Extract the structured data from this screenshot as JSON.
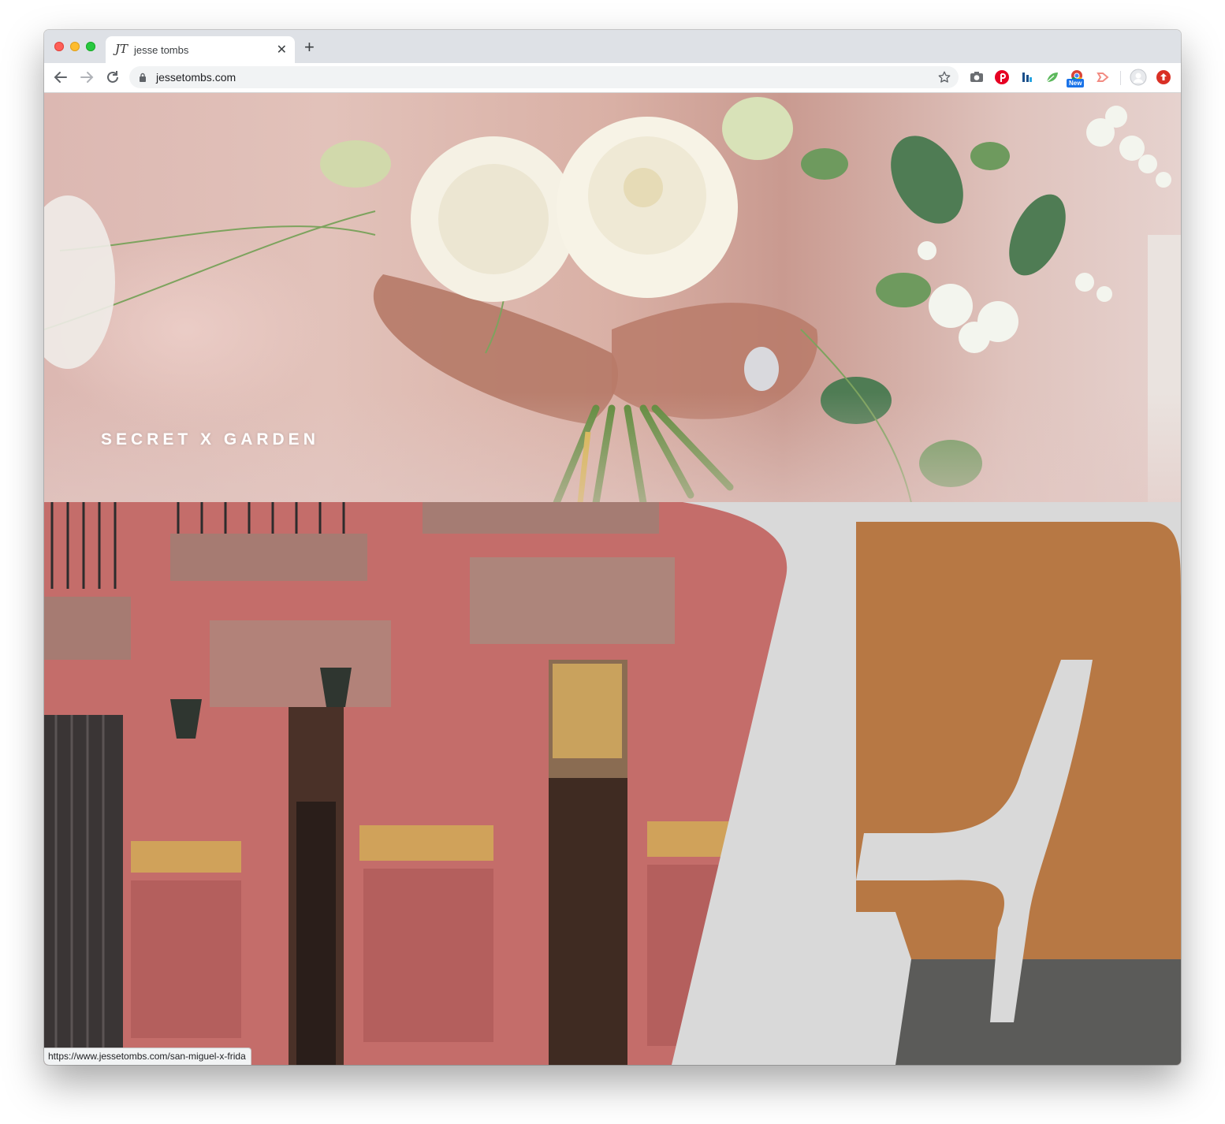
{
  "browser": {
    "tab": {
      "favicon": "JT",
      "title": "jesse tombs"
    },
    "new_tab_label": "+",
    "close_label": "✕",
    "address": "jessetombs.com",
    "extensions": [
      "camera-icon",
      "pinterest-icon",
      "analytics-icon",
      "leaf-icon",
      "chrome-extension-icon",
      "share-icon",
      "avatar-icon",
      "update-icon"
    ],
    "new_badge": "New"
  },
  "page": {
    "hero1_caption": "SECRET X GARDEN",
    "hero1_image": "bride-holding-white-flower-bouquet",
    "hero2_image": "pink-colonial-building-facade",
    "hero2_overlay_letter": "F"
  },
  "status_bar": "https://www.jessetombs.com/san-miguel-x-frida",
  "colors": {
    "tabstrip": "#dee1e6",
    "overlay": "#d9d9d9",
    "wall_pink": "#c56e6b",
    "wall_ochre": "#b97a45"
  }
}
